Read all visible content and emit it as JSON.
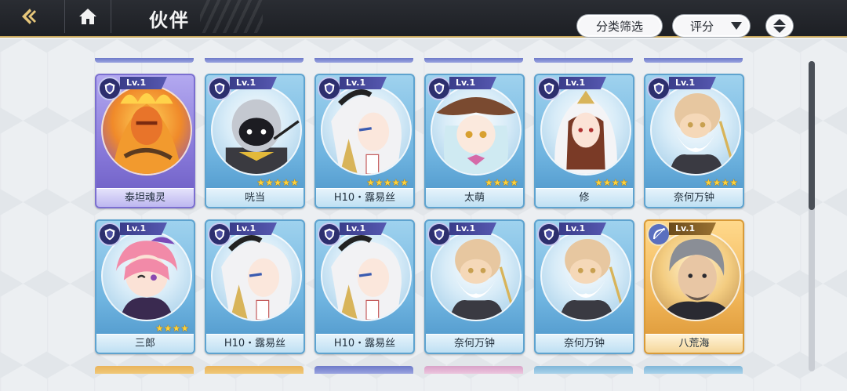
{
  "header": {
    "title": "伙伴"
  },
  "filters": {
    "category_label": "分类筛选",
    "sort_label": "评分"
  },
  "cards": [
    {
      "name": "泰坦魂灵",
      "level": "Lv.1",
      "stars": "",
      "frame": "purple",
      "portrait": "fire"
    },
    {
      "name": "咣当",
      "level": "Lv.1",
      "stars": "★★★★★",
      "frame": "blue",
      "portrait": "knight"
    },
    {
      "name": "H10・露易丝",
      "level": "Lv.1",
      "stars": "★★★★★",
      "frame": "blue",
      "portrait": "girl-white"
    },
    {
      "name": "太萌",
      "level": "Lv.1",
      "stars": "★★★★",
      "frame": "blue",
      "portrait": "girl-hat"
    },
    {
      "name": "修",
      "level": "Lv.1",
      "stars": "★★★★",
      "frame": "blue",
      "portrait": "nun"
    },
    {
      "name": "奈何万钟",
      "level": "Lv.1",
      "stars": "★★★★",
      "frame": "blue",
      "portrait": "elder"
    },
    {
      "name": "三郎",
      "level": "Lv.1",
      "stars": "★★★★",
      "frame": "blue",
      "portrait": "pink"
    },
    {
      "name": "H10・露易丝",
      "level": "Lv.1",
      "stars": "",
      "frame": "blue",
      "portrait": "girl-white"
    },
    {
      "name": "H10・露易丝",
      "level": "Lv.1",
      "stars": "",
      "frame": "blue",
      "portrait": "girl-white"
    },
    {
      "name": "奈何万钟",
      "level": "Lv.1",
      "stars": "",
      "frame": "blue",
      "portrait": "elder"
    },
    {
      "name": "奈何万钟",
      "level": "Lv.1",
      "stars": "",
      "frame": "blue",
      "portrait": "elder"
    },
    {
      "name": "八荒海",
      "level": "Lv.1",
      "stars": "",
      "frame": "gold",
      "portrait": "man-gray"
    }
  ],
  "colors": {
    "topbar": "#1d1f24",
    "accent_gold": "#c9a85c",
    "card_blue": "#6fb4e0",
    "card_purple": "#8677d8",
    "card_gold": "#f0b456"
  },
  "icons": {
    "back": "back-arrow-icon",
    "home": "home-icon",
    "sort_order": "sort-order-icon",
    "class_badge": "shield-class-icon",
    "class_badge_gold": "bow-class-icon"
  }
}
